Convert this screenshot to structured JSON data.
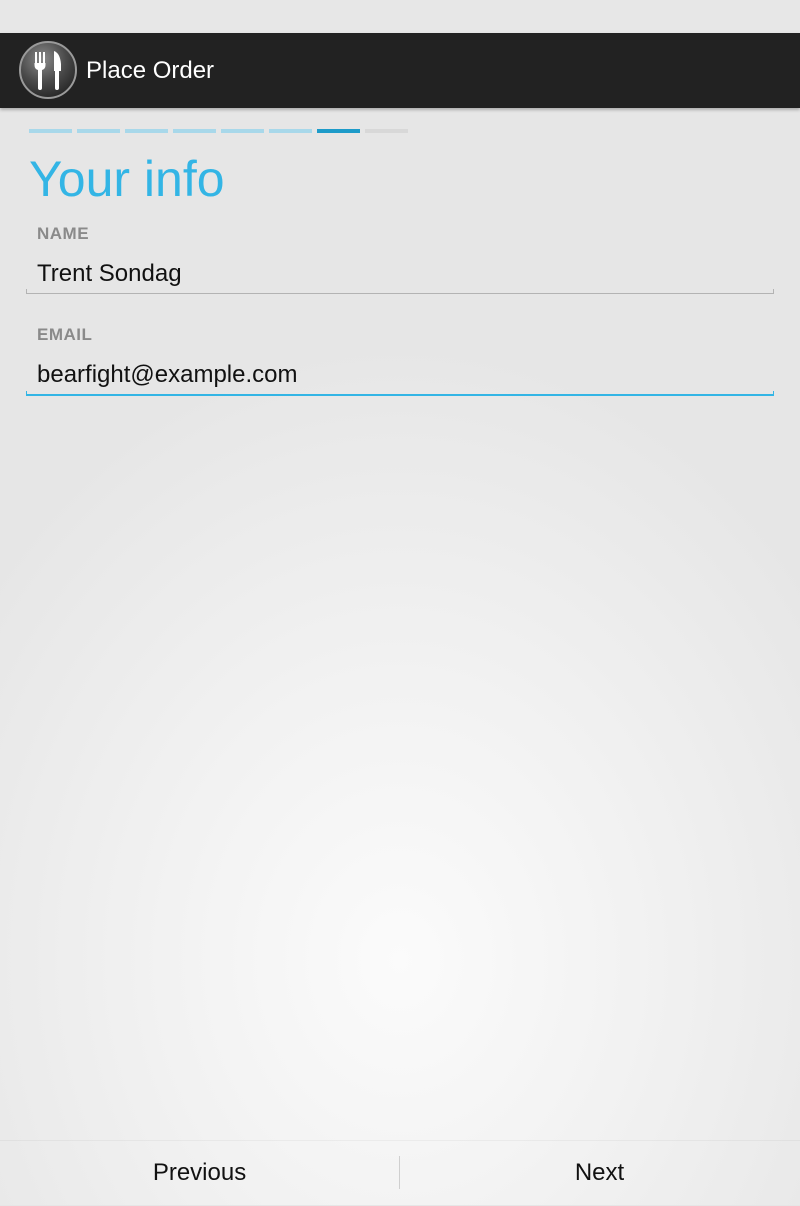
{
  "action_bar": {
    "icon": "fork-knife-icon",
    "title": "Place Order"
  },
  "steps": {
    "total": 8,
    "current": 7,
    "colors": {
      "completed": "#a8d8ea",
      "current": "#1d9bc9",
      "future": "#d8d8d8"
    }
  },
  "form": {
    "title": "Your info",
    "name_label": "NAME",
    "name_value": "Trent Sondag",
    "email_label": "EMAIL",
    "email_value": "bearfight@example.com"
  },
  "buttons": {
    "previous": "Previous",
    "next": "Next"
  },
  "colors": {
    "accent": "#33b5e5",
    "action_bar": "#222222"
  }
}
